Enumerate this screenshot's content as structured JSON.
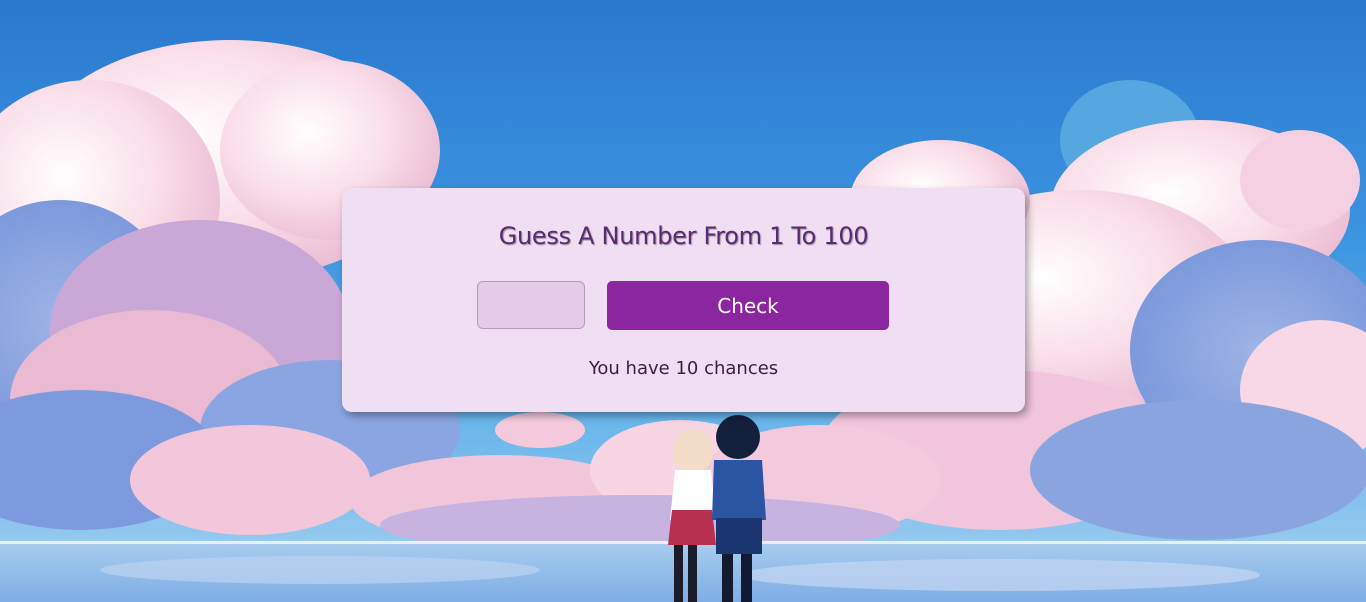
{
  "game": {
    "title": "Guess A Number From 1 To 100",
    "input_value": "",
    "input_placeholder": "",
    "check_label": "Check",
    "chances_text": "You have 10 chances"
  },
  "colors": {
    "card_background": "#f0def3",
    "button": "#8c26a0",
    "title_text": "#5a2a74"
  }
}
